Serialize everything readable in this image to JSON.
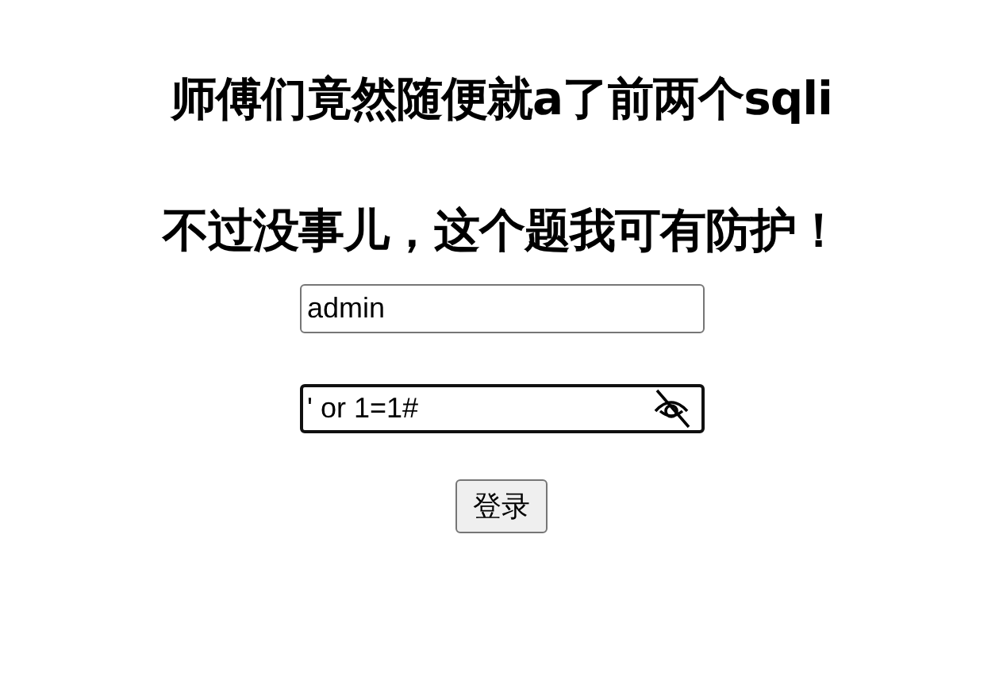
{
  "headings": [
    "师傅们竟然随便就a了前两个sqli",
    "不过没事儿，这个题我可有防护！"
  ],
  "fields": [
    {
      "value": "admin",
      "focused": false
    },
    {
      "value": "' or 1=1#",
      "focused": true,
      "reveal_toggle": true
    }
  ],
  "button": "登录"
}
